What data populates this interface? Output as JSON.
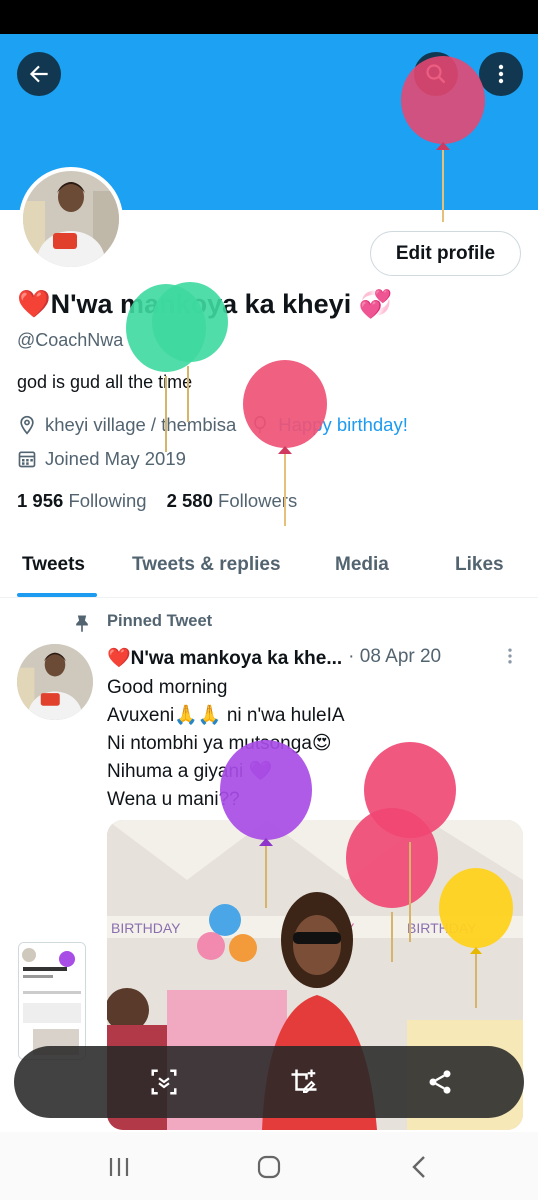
{
  "profile": {
    "name": "❤️N'wa mankoya ka kheyi 💞",
    "handle": "@CoachNwa",
    "bio": "god is gud all the time",
    "location": "kheyi village / thembisa",
    "birthday": "Happy birthday!",
    "joined": "Joined May 2019",
    "following_count": "1 956",
    "following_label": "Following",
    "followers_count": "2 580",
    "followers_label": "Followers"
  },
  "buttons": {
    "edit_profile": "Edit profile"
  },
  "tabs": [
    {
      "label": "Tweets",
      "active": true
    },
    {
      "label": "Tweets & replies",
      "active": false
    },
    {
      "label": "Media",
      "active": false
    },
    {
      "label": "Likes",
      "active": false
    }
  ],
  "tweet": {
    "pinned_label": "Pinned Tweet",
    "author": "❤️N'wa mankoya ka khe...",
    "date": "· 08 Apr 20",
    "lines": [
      "Good morning",
      "Avuxeni🙏🙏 ni n'wa huleIA",
      " Ni ntombhi ya mutsonga😍",
      "Nihuma a giyani 💜",
      " Wena u mani??"
    ],
    "photo_banner_text": "BIRTHDAY"
  },
  "icons": {
    "back": "back-arrow-icon",
    "search": "search-icon",
    "more": "more-vertical-icon",
    "location": "location-pin-icon",
    "balloon": "balloon-icon",
    "calendar": "calendar-icon",
    "pin": "pin-icon",
    "tweet_more": "more-vertical-icon",
    "scan": "scan-text-icon",
    "crop_edit": "crop-edit-icon",
    "share": "share-icon",
    "recents": "recent-apps-icon",
    "home": "home-icon",
    "nav_back": "nav-back-icon"
  },
  "colors": {
    "banner": "#1da1f2",
    "accent": "#1d9bf0",
    "balloon_pink": "#e9476f",
    "balloon_green": "#3ed9a0",
    "balloon_purple": "#a84de6",
    "balloon_yellow": "#ffd21f"
  }
}
